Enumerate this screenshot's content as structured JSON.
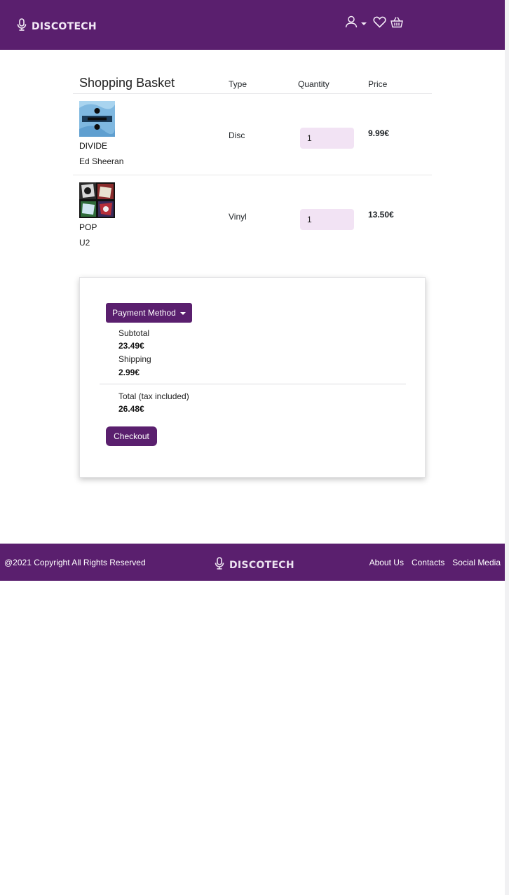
{
  "header": {
    "brand": "DISCOTECH",
    "icons": [
      "microphone-icon",
      "user-icon",
      "heart-icon",
      "basket-icon"
    ],
    "bg_color": "#5a1f6e"
  },
  "basket": {
    "title": "Shopping Basket",
    "columns": {
      "type": "Type",
      "quantity": "Quantity",
      "price": "Price"
    },
    "items": [
      {
        "album": "DIVIDE",
        "artist": "Ed Sheeran",
        "type": "Disc",
        "quantity": "1",
        "price": "9.99€"
      },
      {
        "album": "POP",
        "artist": "U2",
        "type": "Vinyl",
        "quantity": "1",
        "price": "13.50€"
      }
    ]
  },
  "summary": {
    "payment_button": "Payment Method",
    "subtotal_label": "Subtotal",
    "subtotal_value": "23.49€",
    "shipping_label": "Shipping",
    "shipping_value": "2.99€",
    "total_label": "Total (tax included)",
    "total_value": "26.48€",
    "checkout_label": "Checkout"
  },
  "footer": {
    "copyright": "@2021 Copyright All Rights Reserved",
    "brand": "DISCOTECH",
    "links": [
      "About Us",
      "Contacts",
      "Social Media"
    ]
  },
  "colors": {
    "accent": "#5a1f6e",
    "input_bg": "#f2e3f4"
  }
}
